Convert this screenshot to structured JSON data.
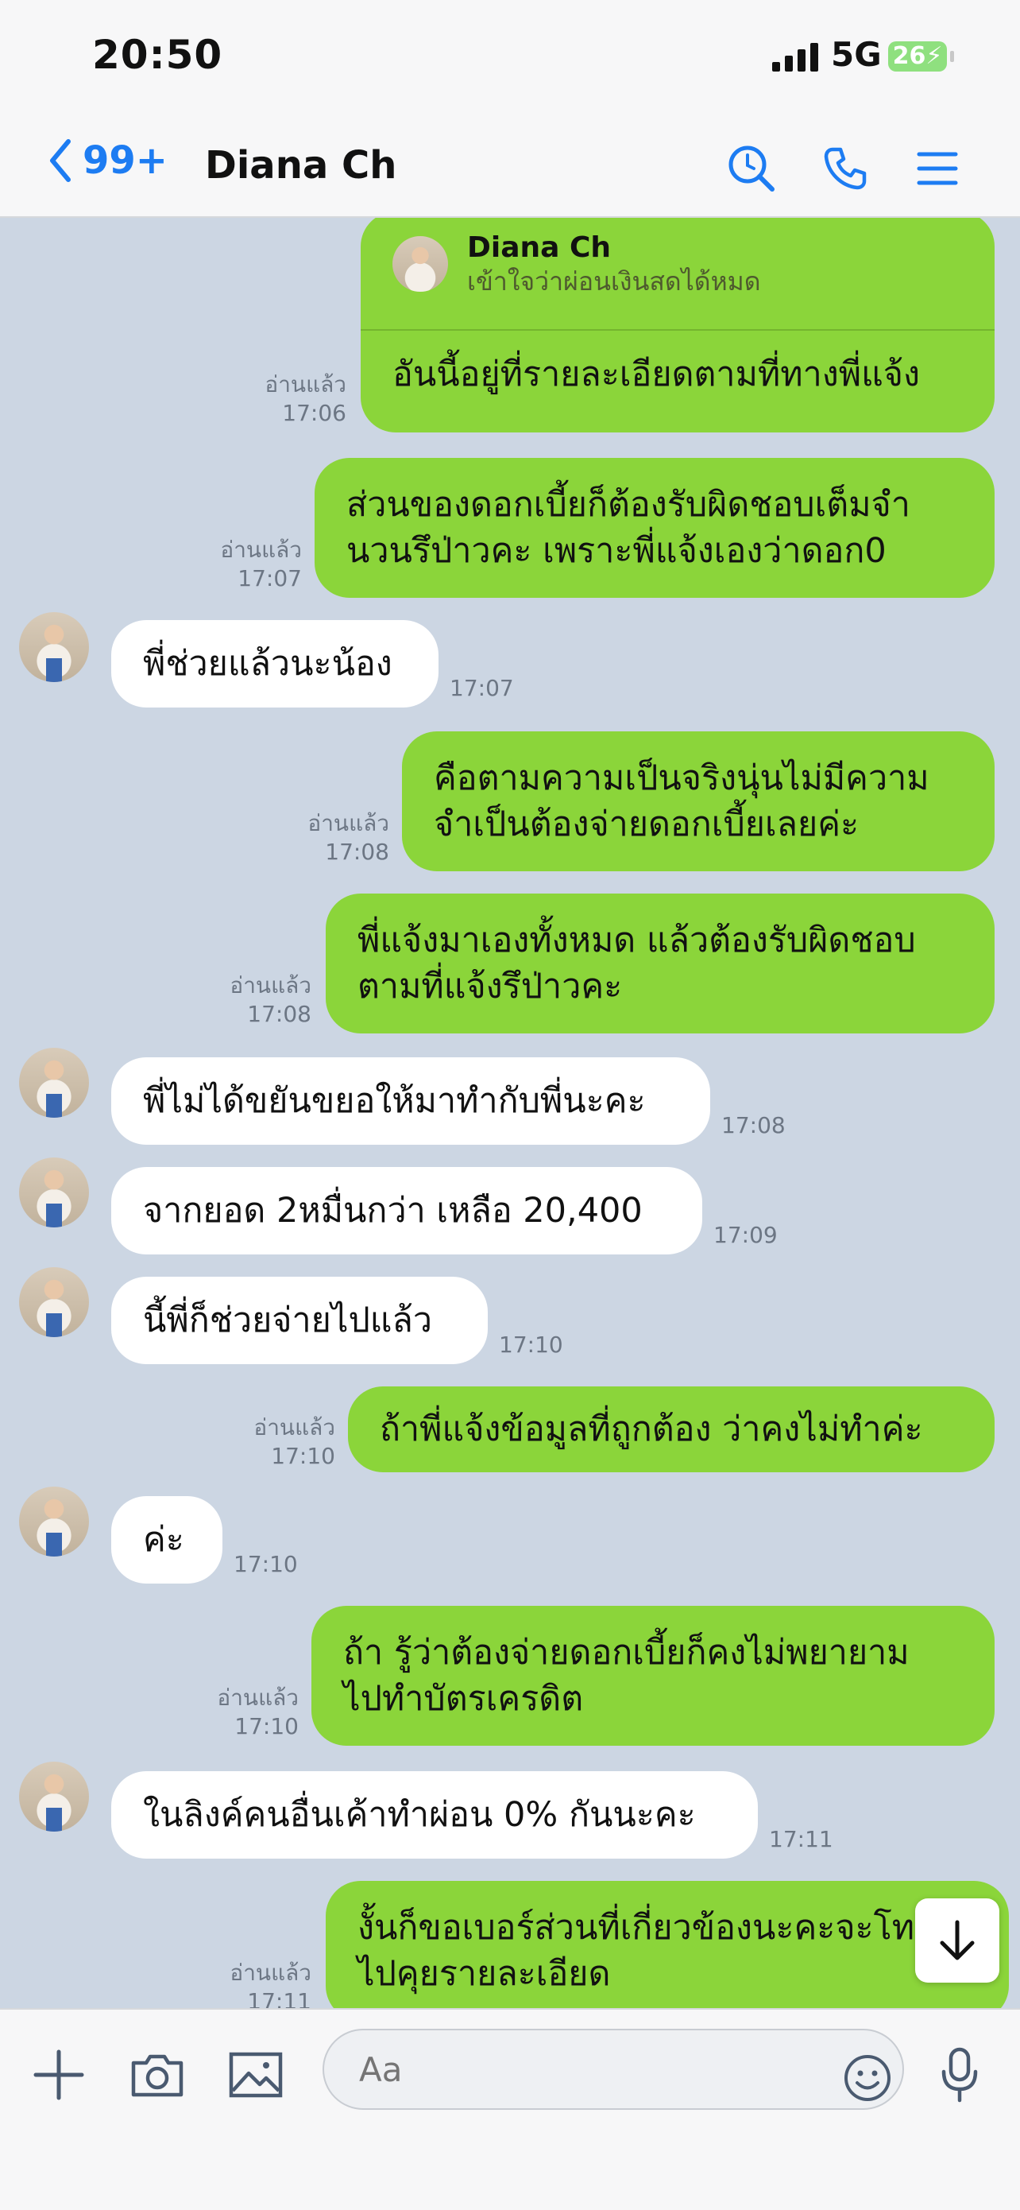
{
  "status_bar": {
    "time": "20:50",
    "network": "5G",
    "battery": "26"
  },
  "header": {
    "back_count": "99+",
    "title": "Diana Ch"
  },
  "messages": [
    {
      "side": "sent",
      "reply_to": {
        "name": "Diana Ch",
        "text": "เข้าใจว่าผ่อนเงินสดได้หมด"
      },
      "lines": [
        "อันนี้อยู่ที่รายละเอียดตามที่ทางพี่แจ้ง"
      ],
      "read": "อ่านแล้ว",
      "time": "17:06"
    },
    {
      "side": "sent",
      "lines": [
        "ส่วนของดอกเบี้ยก็ต้องรับผิดชอบเต็มจำ",
        "นวนรึป่าวคะ เพราะพี่แจ้งเองว่าดอก0"
      ],
      "read": "อ่านแล้ว",
      "time": "17:07"
    },
    {
      "side": "recv",
      "lines": [
        "พี่ช่วยแล้วนะน้อง"
      ],
      "time": "17:07"
    },
    {
      "side": "sent",
      "lines": [
        "คือตามความเป็นจริงนุ่นไม่มีความ",
        "จำเป็นต้องจ่ายดอกเบี้ยเลยค่ะ"
      ],
      "read": "อ่านแล้ว",
      "time": "17:08"
    },
    {
      "side": "sent",
      "lines": [
        "พี่แจ้งมาเองทั้งหมด แล้วต้องรับผิดชอบ",
        "ตามที่แจ้งรึป่าวคะ"
      ],
      "read": "อ่านแล้ว",
      "time": "17:08"
    },
    {
      "side": "recv",
      "lines": [
        "พี่ไม่ได้ขยันขยอให้มาทำกับพี่นะคะ"
      ],
      "time": "17:08"
    },
    {
      "side": "recv",
      "lines": [
        "จากยอด 2หมื่นกว่า เหลือ 20,400"
      ],
      "time": "17:09"
    },
    {
      "side": "recv",
      "lines": [
        "นี้พี่ก็ช่วยจ่ายไปแล้ว"
      ],
      "time": "17:10"
    },
    {
      "side": "sent",
      "lines": [
        "ถ้าพี่แจ้งข้อมูลที่ถูกต้อง ว่าคงไม่ทำค่ะ"
      ],
      "read": "อ่านแล้ว",
      "time": "17:10"
    },
    {
      "side": "recv",
      "lines": [
        "ค่ะ"
      ],
      "time": "17:10"
    },
    {
      "side": "sent",
      "lines": [
        "ถ้า รู้ว่าต้องจ่ายดอกเบี้ยก็คงไม่พยายาม",
        "ไปทำบัตรเครดิต"
      ],
      "read": "อ่านแล้ว",
      "time": "17:10"
    },
    {
      "side": "recv",
      "lines": [
        "ในลิงค์คนอื่นเค้าทำผ่อน 0% กันนะคะ"
      ],
      "time": "17:11"
    },
    {
      "side": "sent",
      "lines": [
        "งั้นก็ขอเบอร์ส่วนที่เกี่ยวข้องนะคะจะโท",
        "ไปคุยรายละเอียด"
      ],
      "read": "อ่านแล้ว",
      "time": "17:11"
    }
  ],
  "composer": {
    "placeholder": "Aa"
  },
  "icons": {
    "back": "chevron-left-icon",
    "search": "search-icon",
    "call": "phone-icon",
    "menu": "menu-icon",
    "plus": "plus-icon",
    "camera": "camera-icon",
    "image": "image-icon",
    "emoji": "emoji-icon",
    "mic": "microphone-icon",
    "scroll": "arrow-down-icon"
  },
  "colors": {
    "sent_bubble": "#8bd53a",
    "received_bubble": "#ffffff",
    "chat_background": "#ccd6e3",
    "accent": "#1d7cf2"
  }
}
